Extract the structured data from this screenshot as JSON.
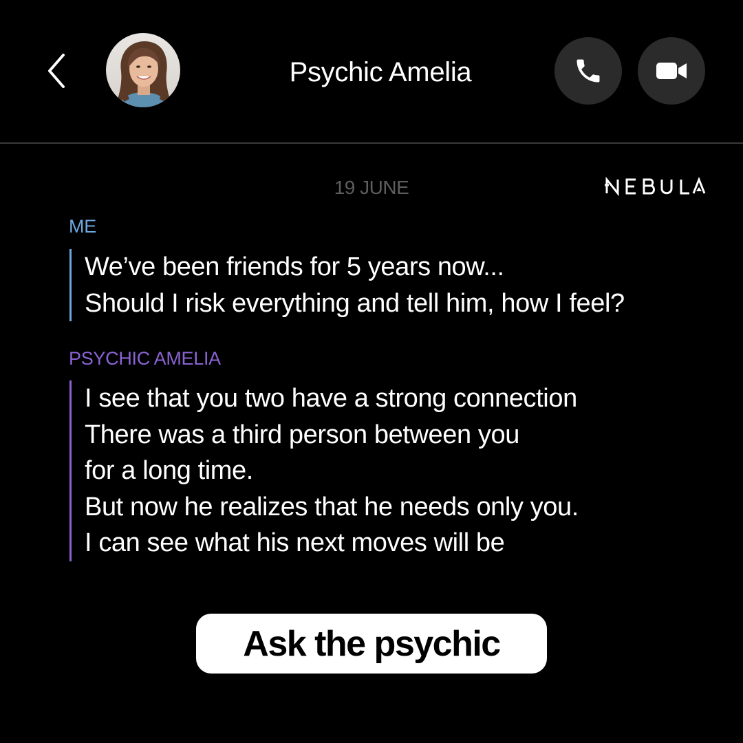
{
  "header": {
    "title": "Psychic Amelia",
    "back_icon": "chevron-left-icon",
    "call_icon": "phone-icon",
    "video_icon": "video-camera-icon"
  },
  "chat": {
    "date": "19 JUNE",
    "brand": "NEBULA",
    "messages": [
      {
        "sender": "ME",
        "sender_color": "#6fa7e0",
        "lines": [
          "We’ve been friends for 5 years now...",
          "Should I risk everything and tell him, how I feel?"
        ]
      },
      {
        "sender": "PSYCHIC AMELIA",
        "sender_color": "#8b63d3",
        "lines": [
          "I see that you two have a strong connection",
          "There was a third person between you",
          "for a long time.",
          "But now he realizes that he needs only you.",
          "I can see what his next moves will be"
        ]
      }
    ]
  },
  "cta": {
    "label": "Ask the psychic"
  },
  "colors": {
    "background": "#000000",
    "button_bg": "#2b2b2b",
    "date_text": "#5e5e5e"
  }
}
